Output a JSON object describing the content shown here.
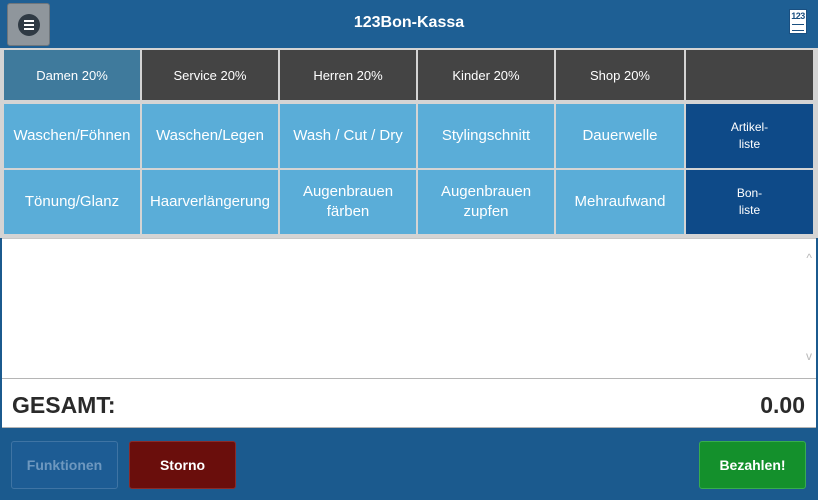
{
  "header": {
    "title": "123Bon-Kassa",
    "menu_icon": "menu-icon",
    "logo_text": "123"
  },
  "categories": [
    {
      "label": "Damen 20%",
      "active": true
    },
    {
      "label": "Service 20%"
    },
    {
      "label": "Herren 20%"
    },
    {
      "label": "Kinder 20%"
    },
    {
      "label": "Shop 20%"
    },
    {
      "label": ""
    }
  ],
  "articles_row1": [
    "Waschen/Föhnen",
    "Waschen/Legen",
    "Wash / Cut / Dry",
    "Stylingschnitt",
    "Dauerwelle"
  ],
  "articles_row2": [
    "Tönung/Glanz",
    "Haarverlängerung",
    "Augenbrauen färben",
    "Augenbrauen zupfen",
    "Mehraufwand"
  ],
  "side_buttons": {
    "artikel": "Artikel-\nliste",
    "bon": "Bon-\nliste"
  },
  "receipt": {
    "scroll_up": "^",
    "scroll_down": "v"
  },
  "total": {
    "label": "GESAMT:",
    "value": "0.00"
  },
  "footer": {
    "funktionen": "Funktionen",
    "storno": "Storno",
    "bezahlen": "Bezahlen!"
  },
  "colors": {
    "header_bg": "#1e5f94",
    "article_bg": "#5aadd8",
    "category_bg": "#444444",
    "category_active_bg": "#3f7a9c",
    "list_button_bg": "#0e4a88",
    "storno_bg": "#6a0e0c",
    "bezahlen_bg": "#14902c"
  }
}
